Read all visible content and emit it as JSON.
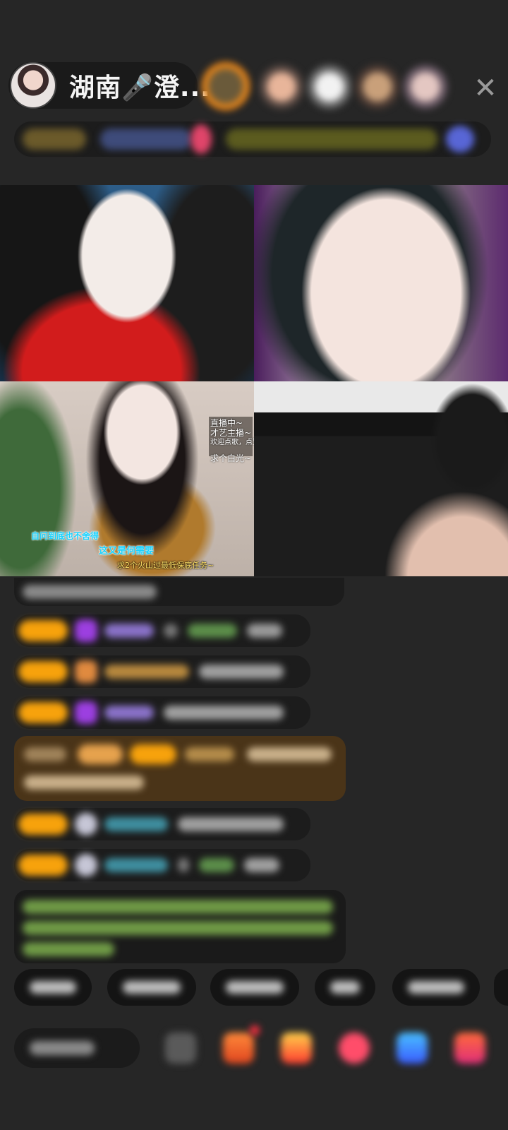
{
  "header": {
    "host_name": "湖南🎤澄...",
    "close_glyph": "✕"
  },
  "video_grid": {
    "tile3_overlay": {
      "box_lines": [
        "直播中~",
        "才艺主播~",
        "欢迎点歌，点赞",
        "求个白光~"
      ],
      "caption1": "自问到底也不舍得",
      "caption2": "这又是何需要",
      "caption3": "求2个火山过最低保底任务~"
    }
  },
  "colors": {
    "background": "#262626",
    "badge_orange": "#f7a20c",
    "comment_bg": "#1c1c1c",
    "gift_banner_bg": "#4a3418"
  },
  "icons": [
    "microphone-icon",
    "close-icon",
    "emoji-icon",
    "gift-box-icon",
    "red-envelope-icon",
    "heart-icon",
    "game-controller-icon",
    "lucky-bag-icon"
  ]
}
